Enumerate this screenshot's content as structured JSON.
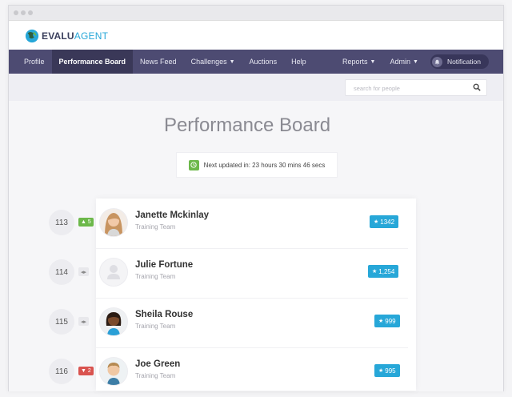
{
  "brand": {
    "part1": "EVALU",
    "part2": "AGENT"
  },
  "nav": {
    "items": [
      {
        "label": "Profile"
      },
      {
        "label": "Performance Board",
        "active": true
      },
      {
        "label": "News Feed"
      },
      {
        "label": "Challenges",
        "dropdown": true
      },
      {
        "label": "Auctions"
      },
      {
        "label": "Help"
      }
    ],
    "right": [
      {
        "label": "Reports",
        "dropdown": true
      },
      {
        "label": "Admin",
        "dropdown": true
      }
    ],
    "notification_label": "Notification"
  },
  "search": {
    "placeholder": "search for people",
    "icon": "search-icon"
  },
  "page": {
    "title": "Performance Board",
    "next_update": "Next updated in: 23 hours 30 mins 46 secs"
  },
  "colors": {
    "nav_bg": "#4d4b72",
    "nav_active": "#3a3858",
    "accent_blue": "#27a7d8",
    "up_green": "#6cb84a",
    "down_red": "#d9534f"
  },
  "rows": [
    {
      "rank": "113",
      "change": "5",
      "direction": "up",
      "name": "Janette Mckinlay",
      "team": "Training Team",
      "score": "1342"
    },
    {
      "rank": "114",
      "change": "",
      "direction": "same",
      "name": "Julie Fortune",
      "team": "Training Team",
      "score": "1,254"
    },
    {
      "rank": "115",
      "change": "",
      "direction": "same",
      "name": "Sheila Rouse",
      "team": "Training Team",
      "score": "999"
    },
    {
      "rank": "116",
      "change": "2",
      "direction": "down",
      "name": "Joe Green",
      "team": "Training Team",
      "score": "995"
    }
  ]
}
